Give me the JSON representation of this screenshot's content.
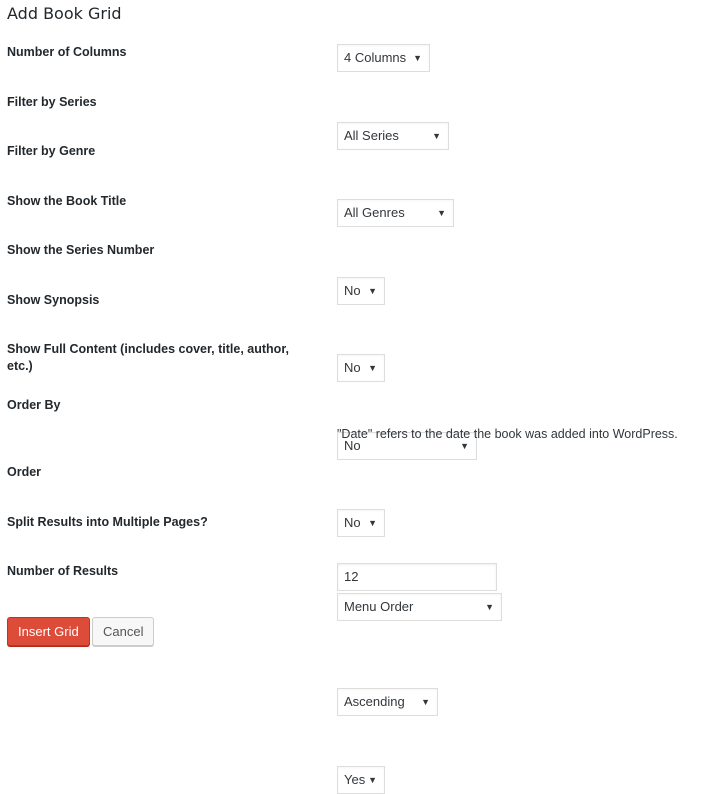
{
  "title": "Add Book Grid",
  "fields": [
    {
      "label": "Number of Columns",
      "value": "4 Columns"
    },
    {
      "label": "Filter by Series",
      "value": "All Series"
    },
    {
      "label": "Filter by Genre",
      "value": "All Genres"
    },
    {
      "label": "Show the Book Title",
      "value": "No"
    },
    {
      "label": "Show the Series Number",
      "value": "No"
    },
    {
      "label": "Show Synopsis",
      "value": "No"
    },
    {
      "label": "Show Full Content (includes cover, title, author, etc.)",
      "value": "No"
    },
    {
      "label": "Order By",
      "value": "Menu Order",
      "description": "\"Date\" refers to the date the book was added into WordPress."
    },
    {
      "label": "Order",
      "value": "Ascending"
    },
    {
      "label": "Split Results into Multiple Pages?",
      "value": "Yes"
    },
    {
      "label": "Number of Results",
      "value": "12"
    }
  ],
  "buttons": {
    "insert": "Insert Grid",
    "cancel": "Cancel"
  },
  "icons": {
    "dropdown_arrow": "▼"
  }
}
